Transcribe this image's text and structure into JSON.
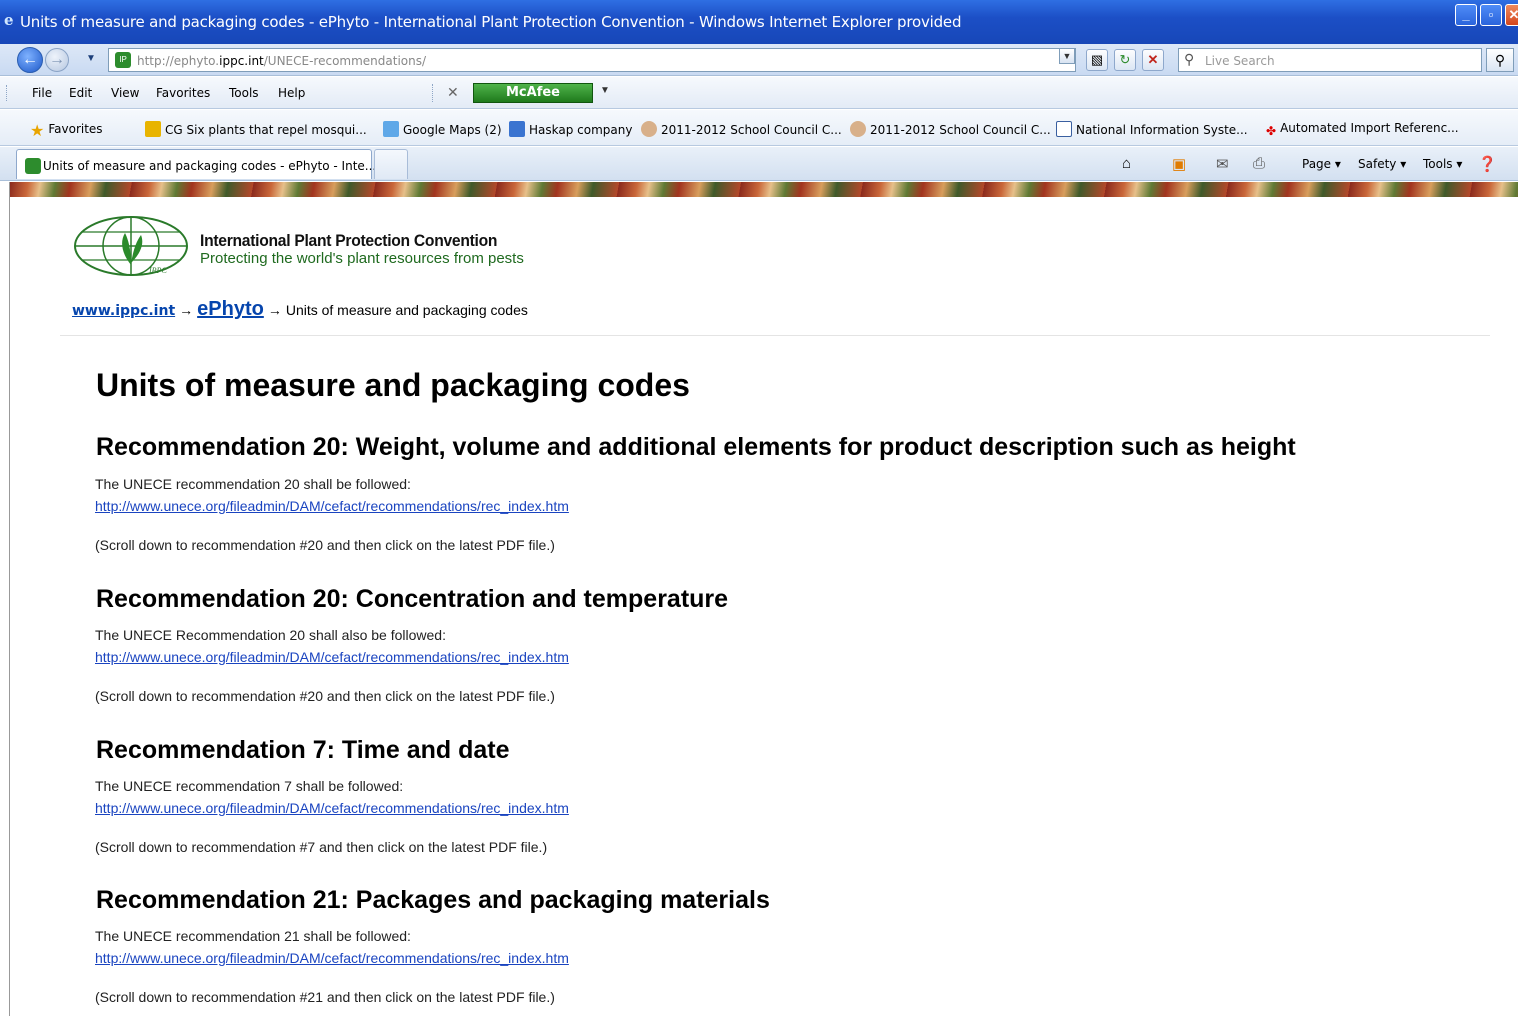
{
  "window": {
    "title": "Units of measure and packaging codes - ePhyto - International Plant Protection Convention - Windows Internet Explorer provided"
  },
  "address_bar": {
    "url_prefix": "http://ephyto.",
    "url_host": "ippc.int",
    "url_path": "/UNECE-recommendations/",
    "search_placeholder": "Live Search"
  },
  "menu": {
    "items": [
      "File",
      "Edit",
      "View",
      "Favorites",
      "Tools",
      "Help"
    ],
    "mcafee_label": "McAfee"
  },
  "favorites_bar": {
    "favorites_label": "Favorites",
    "items": [
      "CG Six plants that repel mosqui...",
      "Google Maps (2)",
      "Haskap company",
      "2011-2012 School Council C...",
      "2011-2012 School Council C...",
      "National Information Syste...",
      "Automated Import Referenc..."
    ]
  },
  "tab_bar": {
    "active_tab": "Units of measure and packaging codes - ePhyto - Inte...",
    "commands": [
      "Page",
      "Safety",
      "Tools"
    ]
  },
  "page": {
    "org_name": "International Plant Protection Convention",
    "org_tagline": "Protecting the world's plant resources from pests",
    "logo_text": "IPPC",
    "breadcrumb": {
      "home": "www.ippc.int",
      "section": "ePhyto",
      "current": "Units of measure and packaging codes",
      "separator": "→"
    },
    "heading": "Units of measure and packaging codes",
    "sections": [
      {
        "title": "Recommendation 20: Weight, volume and additional elements for product description such as height",
        "text": "The UNECE recommendation 20 shall be followed:",
        "link": "http://www.unece.org/fileadmin/DAM/cefact/recommendations/rec_index.htm",
        "note": "(Scroll down to recommendation #20 and then click on the latest PDF file.)"
      },
      {
        "title": "Recommendation 20: Concentration and temperature",
        "text": "The UNECE Recommendation 20 shall also be followed:",
        "link": "http://www.unece.org/fileadmin/DAM/cefact/recommendations/rec_index.htm",
        "note": "(Scroll down to recommendation #20 and then click on the latest PDF file.)"
      },
      {
        "title": "Recommendation 7: Time and date",
        "text": "The UNECE recommendation 7 shall be followed:",
        "link": "http://www.unece.org/fileadmin/DAM/cefact/recommendations/rec_index.htm",
        "note": "(Scroll down to recommendation #7 and then click on the latest PDF file.)"
      },
      {
        "title": "Recommendation 21: Packages and packaging materials",
        "text": "The UNECE recommendation 21 shall be followed:",
        "link": "http://www.unece.org/fileadmin/DAM/cefact/recommendations/rec_index.htm",
        "note": "(Scroll down to recommendation #21 and then click on the latest PDF file.)"
      }
    ]
  }
}
